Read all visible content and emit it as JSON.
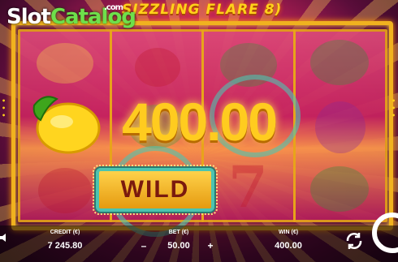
{
  "watermark": {
    "slot": "Slot",
    "catalog": "Catalog",
    "com": ".com"
  },
  "game": {
    "title": "SIZZLING FLARE 8)"
  },
  "win_display": "400.00",
  "wild_label": "WILD",
  "footer": {
    "credit_label": "CREDIT (€)",
    "credit_value": "7 245.80",
    "bet_label": "BET (€)",
    "bet_value": "50.00",
    "bet_minus": "–",
    "bet_plus": "+",
    "win_label": "WIN (€)",
    "win_value": "400.00"
  },
  "icons": {
    "sound": "speaker-icon",
    "autoplay": "refresh-icon",
    "spin": "spin-icon"
  },
  "reels": [
    [
      "lemon",
      "lemon",
      "cherry"
    ],
    [
      "cherry",
      "melon",
      "wild"
    ],
    [
      "melon",
      "seven",
      "seven"
    ],
    [
      "melon",
      "grape",
      "melon"
    ]
  ],
  "colors": {
    "gold": "#f0b21f",
    "win_text": "#ffcc1f",
    "wild_frame": "#4cc4b0"
  }
}
